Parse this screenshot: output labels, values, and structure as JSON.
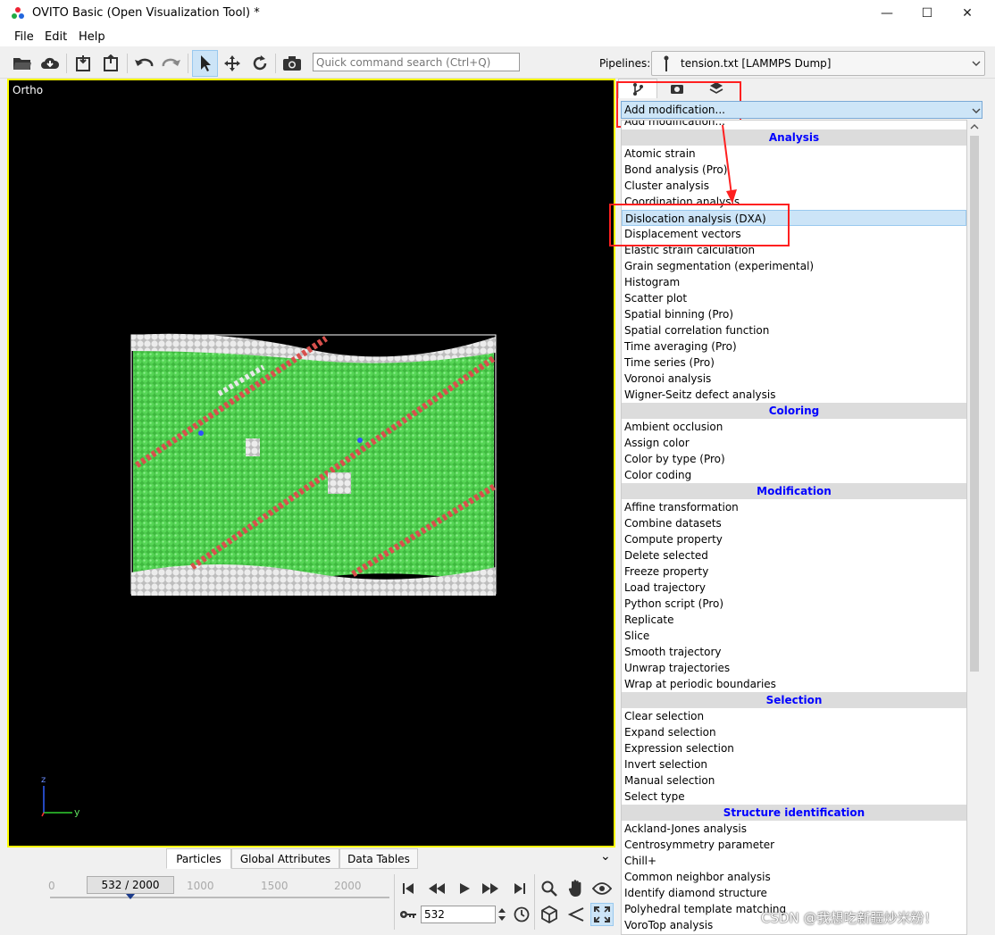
{
  "window": {
    "title": "OVITO Basic (Open Visualization Tool) *",
    "controls": [
      "—",
      "☐",
      "✕"
    ]
  },
  "menubar": {
    "items": [
      "File",
      "Edit",
      "Help"
    ]
  },
  "toolbar": {
    "search_placeholder": "Quick command search (Ctrl+Q)",
    "pipelines_label": "Pipelines:",
    "pipeline_value": "tension.txt [LAMMPS Dump]"
  },
  "viewport": {
    "label": "Ortho",
    "axis_z": "z",
    "axis_y": "y"
  },
  "panel": {
    "combo_value": "Add modification...",
    "list": [
      {
        "kind": "item",
        "label": "Add modification..."
      },
      {
        "kind": "cat",
        "label": "Analysis"
      },
      {
        "kind": "item",
        "label": "Atomic strain"
      },
      {
        "kind": "item",
        "label": "Bond analysis (Pro)"
      },
      {
        "kind": "item",
        "label": "Cluster analysis"
      },
      {
        "kind": "item",
        "label": "Coordination analysis"
      },
      {
        "kind": "item",
        "label": "Dislocation analysis (DXA)",
        "highlighted": true
      },
      {
        "kind": "item",
        "label": "Displacement vectors"
      },
      {
        "kind": "item",
        "label": "Elastic strain calculation"
      },
      {
        "kind": "item",
        "label": "Grain segmentation (experimental)"
      },
      {
        "kind": "item",
        "label": "Histogram"
      },
      {
        "kind": "item",
        "label": "Scatter plot"
      },
      {
        "kind": "item",
        "label": "Spatial binning (Pro)"
      },
      {
        "kind": "item",
        "label": "Spatial correlation function"
      },
      {
        "kind": "item",
        "label": "Time averaging (Pro)"
      },
      {
        "kind": "item",
        "label": "Time series (Pro)"
      },
      {
        "kind": "item",
        "label": "Voronoi analysis"
      },
      {
        "kind": "item",
        "label": "Wigner-Seitz defect analysis"
      },
      {
        "kind": "cat",
        "label": "Coloring"
      },
      {
        "kind": "item",
        "label": "Ambient occlusion"
      },
      {
        "kind": "item",
        "label": "Assign color"
      },
      {
        "kind": "item",
        "label": "Color by type (Pro)"
      },
      {
        "kind": "item",
        "label": "Color coding"
      },
      {
        "kind": "cat",
        "label": "Modification"
      },
      {
        "kind": "item",
        "label": "Affine transformation"
      },
      {
        "kind": "item",
        "label": "Combine datasets"
      },
      {
        "kind": "item",
        "label": "Compute property"
      },
      {
        "kind": "item",
        "label": "Delete selected"
      },
      {
        "kind": "item",
        "label": "Freeze property"
      },
      {
        "kind": "item",
        "label": "Load trajectory"
      },
      {
        "kind": "item",
        "label": "Python script (Pro)"
      },
      {
        "kind": "item",
        "label": "Replicate"
      },
      {
        "kind": "item",
        "label": "Slice"
      },
      {
        "kind": "item",
        "label": "Smooth trajectory"
      },
      {
        "kind": "item",
        "label": "Unwrap trajectories"
      },
      {
        "kind": "item",
        "label": "Wrap at periodic boundaries"
      },
      {
        "kind": "cat",
        "label": "Selection"
      },
      {
        "kind": "item",
        "label": "Clear selection"
      },
      {
        "kind": "item",
        "label": "Expand selection"
      },
      {
        "kind": "item",
        "label": "Expression selection"
      },
      {
        "kind": "item",
        "label": "Invert selection"
      },
      {
        "kind": "item",
        "label": "Manual selection"
      },
      {
        "kind": "item",
        "label": "Select type"
      },
      {
        "kind": "cat",
        "label": "Structure identification"
      },
      {
        "kind": "item",
        "label": "Ackland-Jones analysis"
      },
      {
        "kind": "item",
        "label": "Centrosymmetry parameter"
      },
      {
        "kind": "item",
        "label": "Chill+"
      },
      {
        "kind": "item",
        "label": "Common neighbor analysis"
      },
      {
        "kind": "item",
        "label": "Identify diamond structure"
      },
      {
        "kind": "item",
        "label": "Polyhedral template matching"
      },
      {
        "kind": "item",
        "label": "VoroTop analysis"
      }
    ]
  },
  "bottom": {
    "tabs": [
      "Particles",
      "Global Attributes",
      "Data Tables"
    ],
    "slider_text": "532 / 2000",
    "ticks": [
      "0",
      "1000",
      "1500",
      "2000"
    ],
    "current_frame": "532",
    "collapse_glyph": "⌄"
  },
  "watermark": "CSDN @我想吃新疆炒米粉！",
  "colors": {
    "accent_red": "#ff2020",
    "viewport_border": "#ffff00",
    "category_text": "#0000ff",
    "atom_green": "#4ccc4c",
    "atom_red": "#d8504c",
    "atom_white": "#e8e8e8"
  }
}
